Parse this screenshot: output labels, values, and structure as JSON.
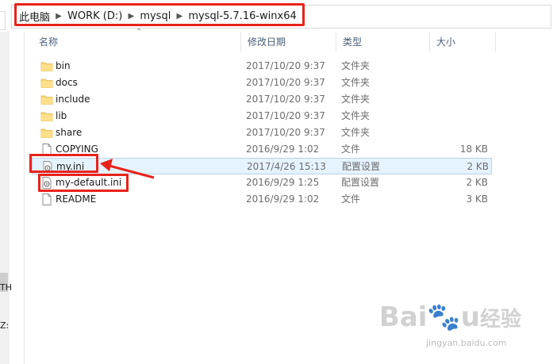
{
  "address": {
    "crumbs": [
      "此电脑",
      "WORK (D:)",
      "mysql",
      "mysql-5.7.16-winx64"
    ]
  },
  "nav": {
    "fragments": [
      "TH",
      "Z:"
    ]
  },
  "columns": {
    "name": "名称",
    "date": "修改日期",
    "type": "类型",
    "size": "大小"
  },
  "files": [
    {
      "name": "bin",
      "date": "2017/10/20 9:37",
      "type": "文件夹",
      "size": "",
      "icon": "folder-icon"
    },
    {
      "name": "docs",
      "date": "2017/10/20 9:37",
      "type": "文件夹",
      "size": "",
      "icon": "folder-icon"
    },
    {
      "name": "include",
      "date": "2017/10/20 9:37",
      "type": "文件夹",
      "size": "",
      "icon": "folder-icon"
    },
    {
      "name": "lib",
      "date": "2017/10/20 9:37",
      "type": "文件夹",
      "size": "",
      "icon": "folder-icon"
    },
    {
      "name": "share",
      "date": "2017/10/20 9:37",
      "type": "文件夹",
      "size": "",
      "icon": "folder-icon"
    },
    {
      "name": "COPYING",
      "date": "2016/9/29 1:02",
      "type": "文件",
      "size": "18 KB",
      "icon": "file-icon"
    },
    {
      "name": "my.ini",
      "date": "2017/4/26 15:13",
      "type": "配置设置",
      "size": "2 KB",
      "icon": "config-file-icon"
    },
    {
      "name": "my-default.ini",
      "date": "2016/9/29 1:25",
      "type": "配置设置",
      "size": "2 KB",
      "icon": "config-file-icon"
    },
    {
      "name": "README",
      "date": "2016/9/29 1:02",
      "type": "文件",
      "size": "3 KB",
      "icon": "file-icon"
    }
  ],
  "watermark": {
    "brand": "Baidu经验",
    "url": "jingyan.baidu.com"
  },
  "colors": {
    "highlight": "#e8231b",
    "folder": "#f8d775",
    "header_text": "#4c607a"
  }
}
